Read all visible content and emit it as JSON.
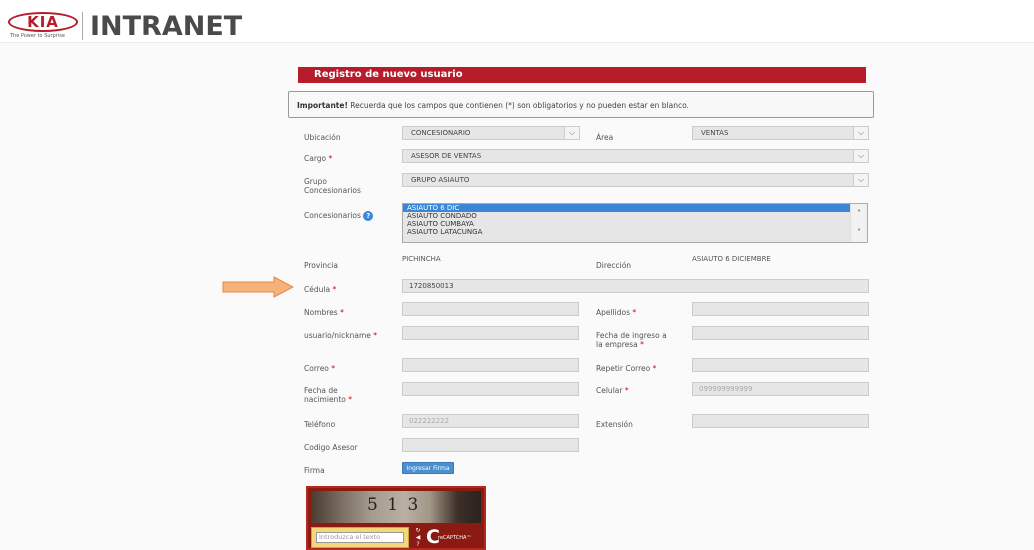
{
  "header": {
    "logo_text": "KIA",
    "tagline": "The Power to Surprise",
    "title": "INTRANET"
  },
  "form": {
    "title": "Registro de nuevo usuario",
    "notice_strong": "Importante!",
    "notice_text": " Recuerda que los campos que contienen (*) son obligatorios y no pueden estar en blanco.",
    "required_mark": "*",
    "ubicacion": {
      "label": "Ubicación",
      "value": "CONCESIONARIO"
    },
    "area": {
      "label": "Área",
      "value": "VENTAS"
    },
    "cargo": {
      "label": "Cargo",
      "value": "ASESOR DE VENTAS"
    },
    "grupo": {
      "label1": "Grupo",
      "label2": "Concesionarios",
      "value": "GRUPO ASIAUTO"
    },
    "concesionarios": {
      "label": "Concesionarios",
      "help": "?",
      "options": [
        "ASIAUTO 6 DIC",
        "ASIAUTO CONDADO",
        "ASIAUTO CUMBAYA",
        "ASIAUTO LATACUNGA"
      ]
    },
    "provincia": {
      "label": "Provincia",
      "value": "PICHINCHA"
    },
    "direccion": {
      "label": "Dirección",
      "value": "ASIAUTO 6 DICIEMBRE"
    },
    "cedula": {
      "label": "Cédula",
      "value": "1720850013"
    },
    "nombres": {
      "label": "Nombres"
    },
    "apellidos": {
      "label": "Apellidos"
    },
    "usuario": {
      "label": "usuario/nickname"
    },
    "fecha_ingreso": {
      "label1": "Fecha de ingreso a",
      "label2": "la empresa"
    },
    "correo": {
      "label": "Correo"
    },
    "repetir_correo": {
      "label": "Repetir Correo"
    },
    "fecha_nacimiento": {
      "label1": "Fecha de",
      "label2": "nacimiento"
    },
    "celular": {
      "label": "Celular",
      "placeholder": "099999999999"
    },
    "telefono": {
      "label": "Teléfono",
      "placeholder": "022222222"
    },
    "extension": {
      "label": "Extensión"
    },
    "codigo_asesor": {
      "label": "Codigo Asesor"
    },
    "firma": {
      "label": "Firma",
      "button": "Ingresar Firma"
    }
  },
  "captcha": {
    "image_text": "5 1 3",
    "input_placeholder": "Introduzca el texto",
    "logo_text": "reCAPTCHA™"
  },
  "colors": {
    "brand_red": "#b71c2b",
    "arrow": "#f7b27a",
    "select_blue": "#3b86d6"
  }
}
